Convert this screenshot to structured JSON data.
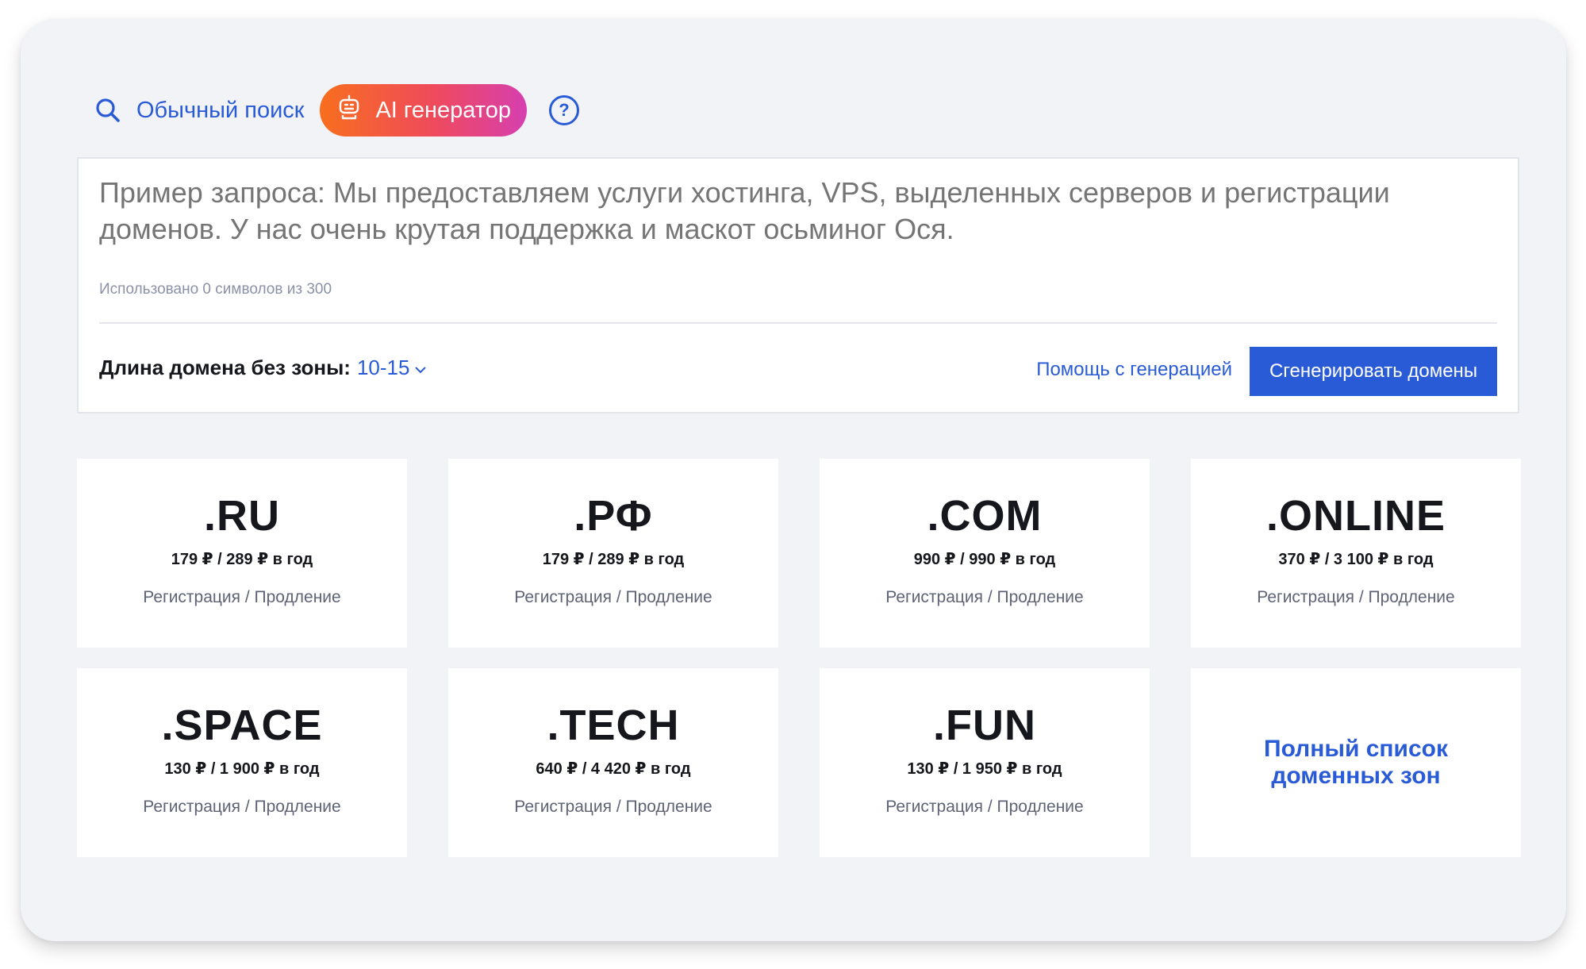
{
  "tabs": {
    "plain_label": "Обычный поиск",
    "ai_label": "AI генератор",
    "help_label": "?"
  },
  "query": {
    "placeholder": "Пример запроса: Мы предоставляем услуги хостинга, VPS, выделенных серверов и регистрации доменов. У нас очень крутая поддержка и маскот осьминог Ося.",
    "value": "",
    "counter": "Использовано 0 символов из 300"
  },
  "length": {
    "label": "Длина домена без зоны:",
    "value": "10-15"
  },
  "actions": {
    "help_label": "Помощь с генерацией",
    "generate_label": "Сгенерировать домены"
  },
  "zones": [
    {
      "zone": ".RU",
      "price": "179 ₽ / 289 ₽ в год",
      "desc": "Регистрация / Продление"
    },
    {
      "zone": ".РФ",
      "price": "179 ₽ / 289 ₽ в год",
      "desc": "Регистрация / Продление"
    },
    {
      "zone": ".COM",
      "price": "990 ₽ / 990 ₽ в год",
      "desc": "Регистрация / Продление"
    },
    {
      "zone": ".ONLINE",
      "price": "370 ₽ / 3 100 ₽ в год",
      "desc": "Регистрация / Продление"
    },
    {
      "zone": ".SPACE",
      "price": "130 ₽ / 1 900 ₽ в год",
      "desc": "Регистрация / Продление"
    },
    {
      "zone": ".TECH",
      "price": "640 ₽ / 4 420 ₽ в год",
      "desc": "Регистрация / Продление"
    },
    {
      "zone": ".FUN",
      "price": "130 ₽ / 1 950 ₽ в год",
      "desc": "Регистрация / Продление"
    }
  ],
  "all_zones_label": "Полный список доменных зон",
  "colors": {
    "accent": "#2a5bd7",
    "ai_gradient_start": "#f86e1e",
    "ai_gradient_end": "#d63fb0",
    "panel_bg": "#f2f3f7",
    "text_dark": "#15171c",
    "text_muted": "#8b91a6"
  },
  "icons": {
    "search": "search-icon",
    "ai": "robot-icon",
    "help": "question-circle-icon",
    "chevron": "chevron-down-icon"
  }
}
